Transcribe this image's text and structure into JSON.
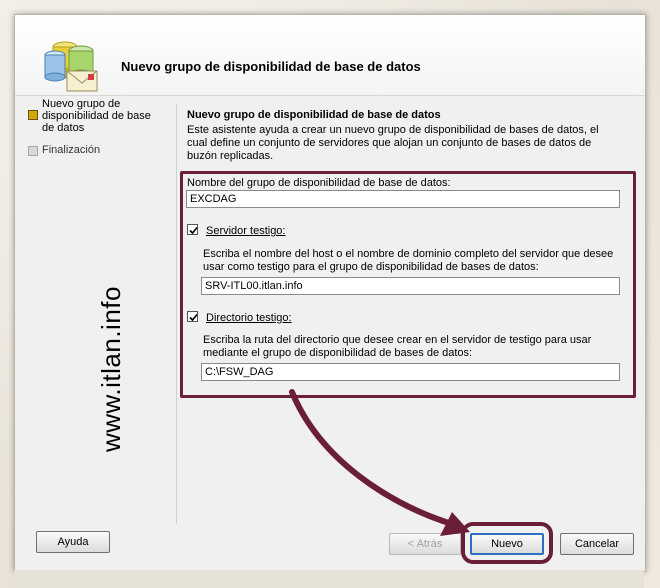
{
  "wizard": {
    "title": "Nuevo grupo de disponibilidad de base de datos",
    "nav": [
      {
        "label": "Nuevo grupo de disponibilidad de base de datos",
        "state": "active"
      },
      {
        "label": "Finalización",
        "state": "inactive"
      }
    ],
    "watermark": "www.itlan.info"
  },
  "content": {
    "title": "Nuevo grupo de disponibilidad de base de datos",
    "description": "Este asistente ayuda a crear un nuevo grupo de disponibilidad de bases de datos, el cual define un conjunto de servidores que alojan un conjunto de bases de datos de buzón replicadas.",
    "group_name_label": "Nombre del grupo de disponibilidad de base de datos:",
    "group_name_value": "EXCDAG",
    "witness_server_label": "Servidor testigo:",
    "witness_server_checked": true,
    "witness_server_help": "Escriba el nombre del host o el nombre de dominio completo del servidor que desee usar como testigo para el grupo de disponibilidad de bases de datos:",
    "witness_server_value": "SRV-ITL00.itlan.info",
    "witness_dir_label": "Directorio testigo:",
    "witness_dir_checked": true,
    "witness_dir_help": "Escriba la ruta del directorio que desee crear en el servidor de testigo para usar mediante el grupo de disponibilidad de bases de datos:",
    "witness_dir_value": "C:\\FSW_DAG"
  },
  "buttons": {
    "help": "Ayuda",
    "back": "< Atrás",
    "next": "Nuevo",
    "cancel": "Cancelar"
  },
  "colors": {
    "annotation": "#6b1e3a",
    "active_step": "#d2a60c"
  }
}
